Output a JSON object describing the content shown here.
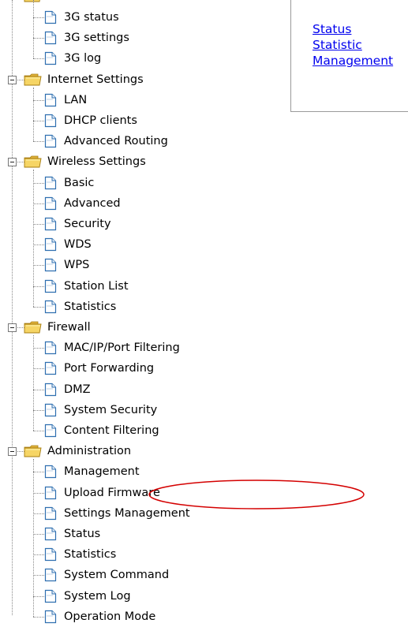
{
  "links": [
    {
      "name": "link-status",
      "label": "Status"
    },
    {
      "name": "link-statistic",
      "label": "Statistic"
    },
    {
      "name": "link-management",
      "label": "Management"
    }
  ],
  "groups": [
    {
      "name": "3g",
      "label": "",
      "expanded": true,
      "items": [
        "3G status",
        "3G settings",
        "3G log"
      ]
    },
    {
      "name": "internet-settings",
      "label": "Internet Settings",
      "expanded": true,
      "items": [
        "LAN",
        "DHCP clients",
        "Advanced Routing"
      ]
    },
    {
      "name": "wireless-settings",
      "label": "Wireless Settings",
      "expanded": true,
      "items": [
        "Basic",
        "Advanced",
        "Security",
        "WDS",
        "WPS",
        "Station List",
        "Statistics"
      ]
    },
    {
      "name": "firewall",
      "label": "Firewall",
      "expanded": true,
      "items": [
        "MAC/IP/Port Filtering",
        "Port Forwarding",
        "DMZ",
        "System Security",
        "Content Filtering"
      ]
    },
    {
      "name": "administration",
      "label": "Administration",
      "expanded": true,
      "items": [
        "Management",
        "Upload Firmware",
        "Settings Management",
        "Status",
        "Statistics",
        "System Command",
        "System Log",
        "Operation Mode"
      ]
    }
  ],
  "annotation": {
    "type": "red-oval-highlight",
    "target": "Upload Firmware",
    "color": "#d40000"
  },
  "colors": {
    "link": "#0000ee",
    "folder": "#f2c94c",
    "doc_border": "#2f6fb0"
  }
}
